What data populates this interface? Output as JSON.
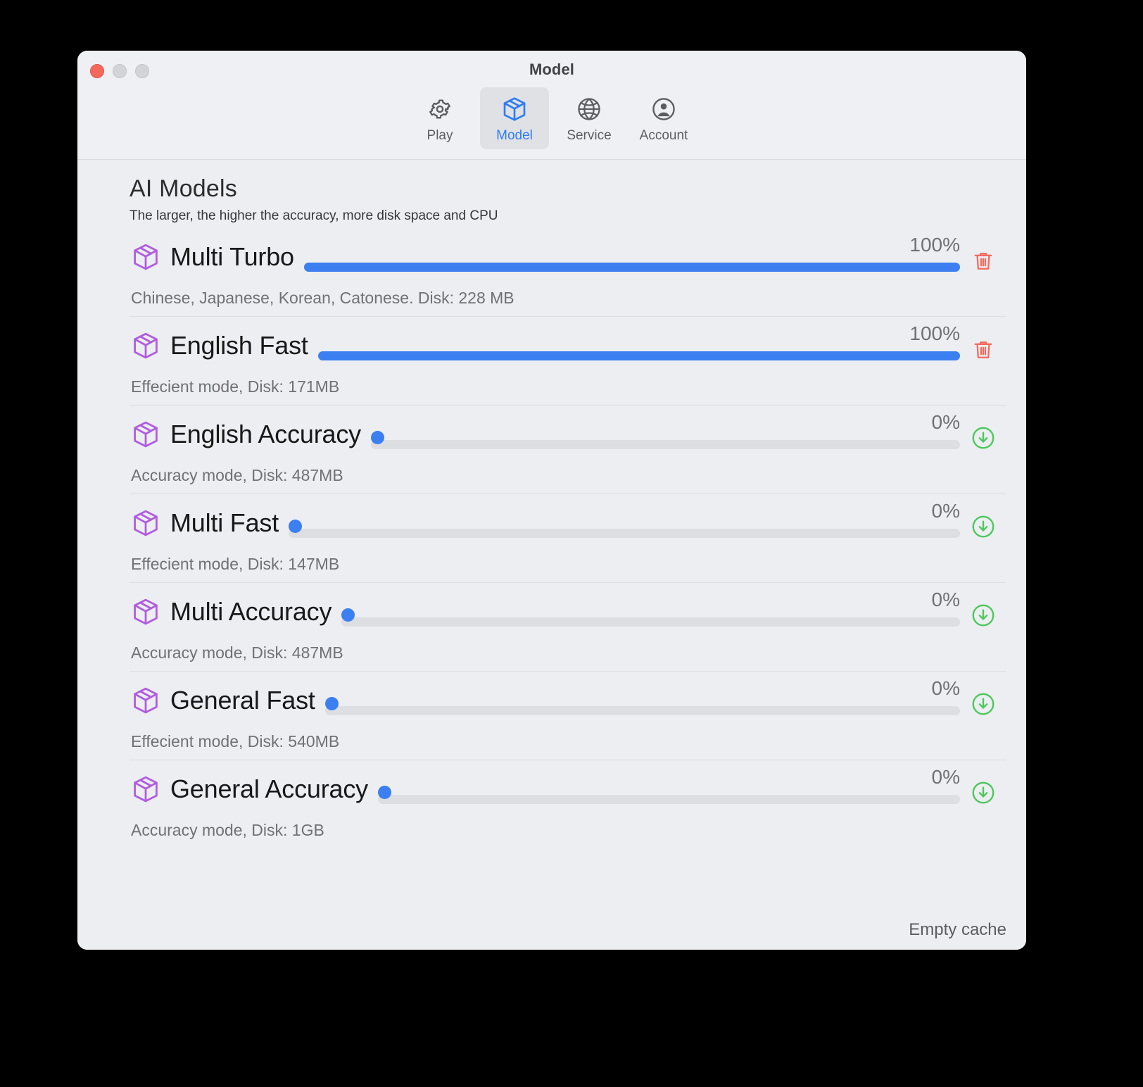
{
  "window": {
    "title": "Model",
    "traffic_lights": [
      {
        "name": "close",
        "color": "#f4695c"
      },
      {
        "name": "minimize",
        "color": "#d2d4d7"
      },
      {
        "name": "maximize",
        "color": "#d2d4d7"
      }
    ]
  },
  "toolbar": {
    "active_tab": "Model",
    "tabs": [
      {
        "label": "Play",
        "icon": "gear-icon"
      },
      {
        "label": "Model",
        "icon": "cube-icon"
      },
      {
        "label": "Service",
        "icon": "globe-icon"
      },
      {
        "label": "Account",
        "icon": "person-circle-icon"
      }
    ]
  },
  "main": {
    "heading": "AI Models",
    "subheading": "The larger, the higher the accuracy, more disk space and CPU",
    "models": [
      {
        "name": "Multi Turbo",
        "progress_label": "100%",
        "progress": 100,
        "detail": "Chinese, Japanese, Korean, Catonese. Disk: 228 MB",
        "action": "delete",
        "action_icon": "trash-icon"
      },
      {
        "name": "English Fast",
        "progress_label": "100%",
        "progress": 100,
        "detail": "Effecient mode, Disk: 171MB",
        "action": "delete",
        "action_icon": "trash-icon"
      },
      {
        "name": "English Accuracy",
        "progress_label": "0%",
        "progress": 0,
        "detail": "Accuracy mode, Disk: 487MB",
        "action": "download",
        "action_icon": "download-circle-icon"
      },
      {
        "name": "Multi Fast",
        "progress_label": "0%",
        "progress": 0,
        "detail": "Effecient mode, Disk: 147MB",
        "action": "download",
        "action_icon": "download-circle-icon"
      },
      {
        "name": "Multi Accuracy",
        "progress_label": "0%",
        "progress": 0,
        "detail": "Accuracy mode, Disk: 487MB",
        "action": "download",
        "action_icon": "download-circle-icon"
      },
      {
        "name": "General Fast",
        "progress_label": "0%",
        "progress": 0,
        "detail": "Effecient mode, Disk: 540MB",
        "action": "download",
        "action_icon": "download-circle-icon"
      },
      {
        "name": "General Accuracy",
        "progress_label": "0%",
        "progress": 0,
        "detail": "Accuracy mode, Disk: 1GB",
        "action": "download",
        "action_icon": "download-circle-icon"
      }
    ]
  },
  "footer": {
    "empty_cache_label": "Empty cache"
  },
  "colors": {
    "accent_blue": "#3b7ff0",
    "tab_active_text": "#2f7df6",
    "cube_purple": "#b05ce0",
    "delete_red": "#f4695c",
    "download_green": "#4cc85a",
    "window_bg": "#eceef1",
    "titlebar_bg": "#eef0f3"
  }
}
